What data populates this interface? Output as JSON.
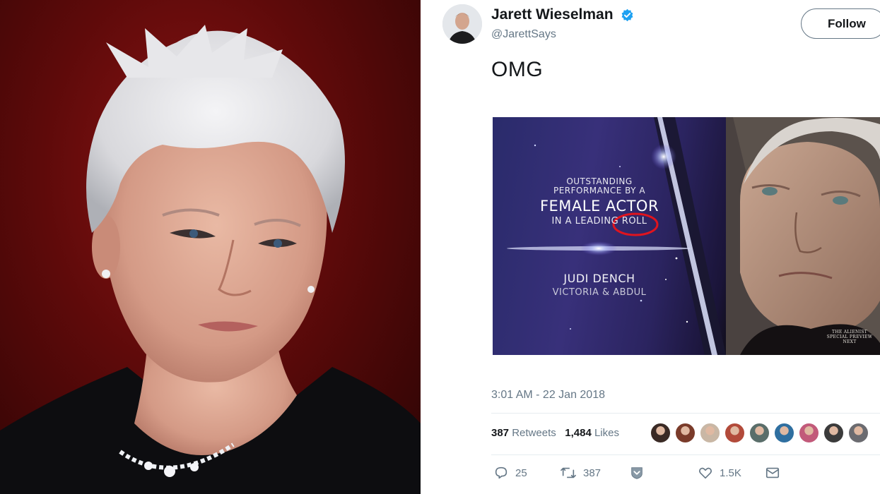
{
  "tweet": {
    "display_name": "Jarett Wieselman",
    "handle": "@JarettSays",
    "follow_label": "Follow",
    "text": "OMG",
    "timestamp": "3:01 AM - 22 Jan 2018",
    "retweets_count": "387",
    "retweets_label": "Retweets",
    "likes_count": "1,484",
    "likes_label": "Likes",
    "liker_count": 9,
    "actions": {
      "reply_count": "25",
      "retweet_count": "387",
      "like_count": "1.5K"
    },
    "colors": {
      "verified": "#1da1f2",
      "text_secondary": "#657786",
      "text_primary": "#14171a"
    },
    "icons": [
      "verified-icon",
      "reply-icon",
      "retweet-icon",
      "dm-heart-icon",
      "like-icon",
      "message-icon"
    ]
  },
  "media": {
    "award_line1": "OUTSTANDING",
    "award_line2": "PERFORMANCE BY A",
    "award_line3": "FEMALE ACTOR",
    "award_line4": "IN A LEADING ROLL",
    "nominee": "JUDI DENCH",
    "film": "VICTORIA & ABDUL",
    "preview_line1": "THE ALIENIST",
    "preview_line2": "SPECIAL PREVIEW NEXT",
    "highlight_color": "#e0141e"
  }
}
